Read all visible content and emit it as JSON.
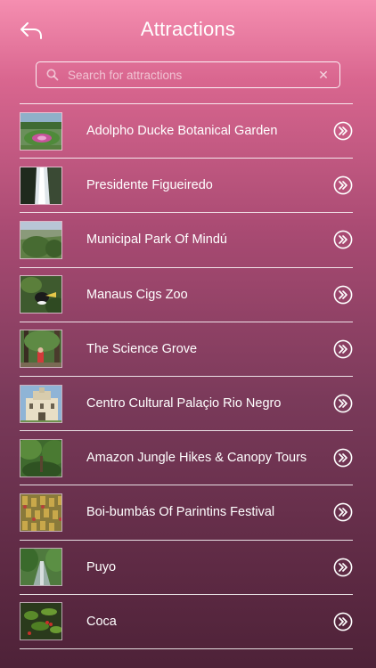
{
  "header": {
    "title": "Attractions",
    "back_icon": "back-arrow-icon"
  },
  "search": {
    "placeholder": "Search for attractions",
    "value": ""
  },
  "attractions": [
    {
      "name": "Adolpho Ducke Botanical Garden",
      "thumb": "garden"
    },
    {
      "name": "Presidente Figueiredo",
      "thumb": "waterfall"
    },
    {
      "name": "Municipal Park Of Mindú",
      "thumb": "park"
    },
    {
      "name": "Manaus Cigs Zoo",
      "thumb": "zoo"
    },
    {
      "name": "The Science Grove",
      "thumb": "grove"
    },
    {
      "name": "Centro Cultural Palaçio Rio Negro",
      "thumb": "palace"
    },
    {
      "name": "Amazon Jungle Hikes & Canopy Tours",
      "thumb": "jungle"
    },
    {
      "name": "Boi-bumbás Of Parintins Festival",
      "thumb": "festival"
    },
    {
      "name": "Puyo",
      "thumb": "puyo"
    },
    {
      "name": "Coca",
      "thumb": "coca"
    }
  ],
  "colors": {
    "gradient_top": "#f58eb0",
    "gradient_bottom": "#4e2238",
    "text": "#ffffff"
  }
}
